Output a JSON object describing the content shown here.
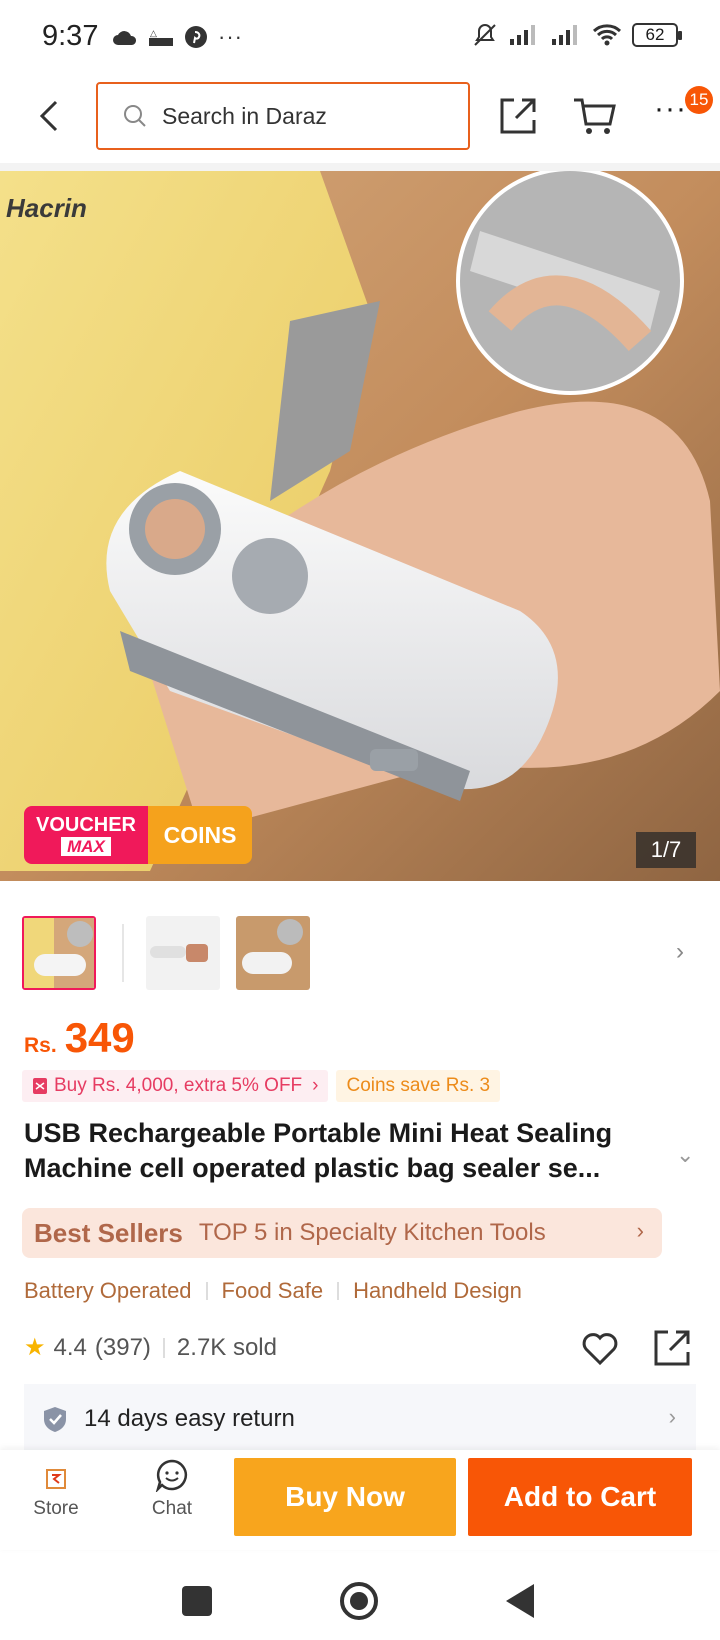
{
  "status_bar": {
    "time": "9:37",
    "battery": "62",
    "icons_left": [
      "cloud-icon",
      "temu-icon",
      "pinterest-icon",
      "more-dots-icon"
    ],
    "icons_right": [
      "mute-icon",
      "signal-icon",
      "signal-icon",
      "wifi-icon",
      "battery-icon"
    ]
  },
  "header": {
    "search_placeholder": "Search in Daraz",
    "notification_count": "15"
  },
  "hero": {
    "voucher_line1": "VOUCHER",
    "voucher_line2": "MAX",
    "coins_label": "COINS",
    "counter": "1/7",
    "brand_watermark": "Hacrin"
  },
  "price": {
    "currency": "Rs.",
    "amount": "349"
  },
  "promos": {
    "voucher": "Buy Rs. 4,000, extra 5% OFF",
    "coins": "Coins save Rs. 3"
  },
  "product": {
    "title": "USB Rechargeable Portable Mini Heat Sealing Machine cell operated plastic bag sealer se..."
  },
  "best_sellers": {
    "tag": "Best Sellers",
    "text": "TOP 5 in Specialty Kitchen Tools"
  },
  "features": [
    "Battery Operated",
    "Food Safe",
    "Handheld Design"
  ],
  "rating": {
    "score": "4.4",
    "count": "(397)",
    "sold": "2.7K sold"
  },
  "return_policy": "14 days easy return",
  "bottom_bar": {
    "store_label": "Store",
    "chat_label": "Chat",
    "buy_now": "Buy Now",
    "add_to_cart": "Add to Cart"
  },
  "colors": {
    "brand_orange": "#f85606",
    "buy_now": "#f8a51d",
    "voucher_pink": "#f0195a"
  }
}
